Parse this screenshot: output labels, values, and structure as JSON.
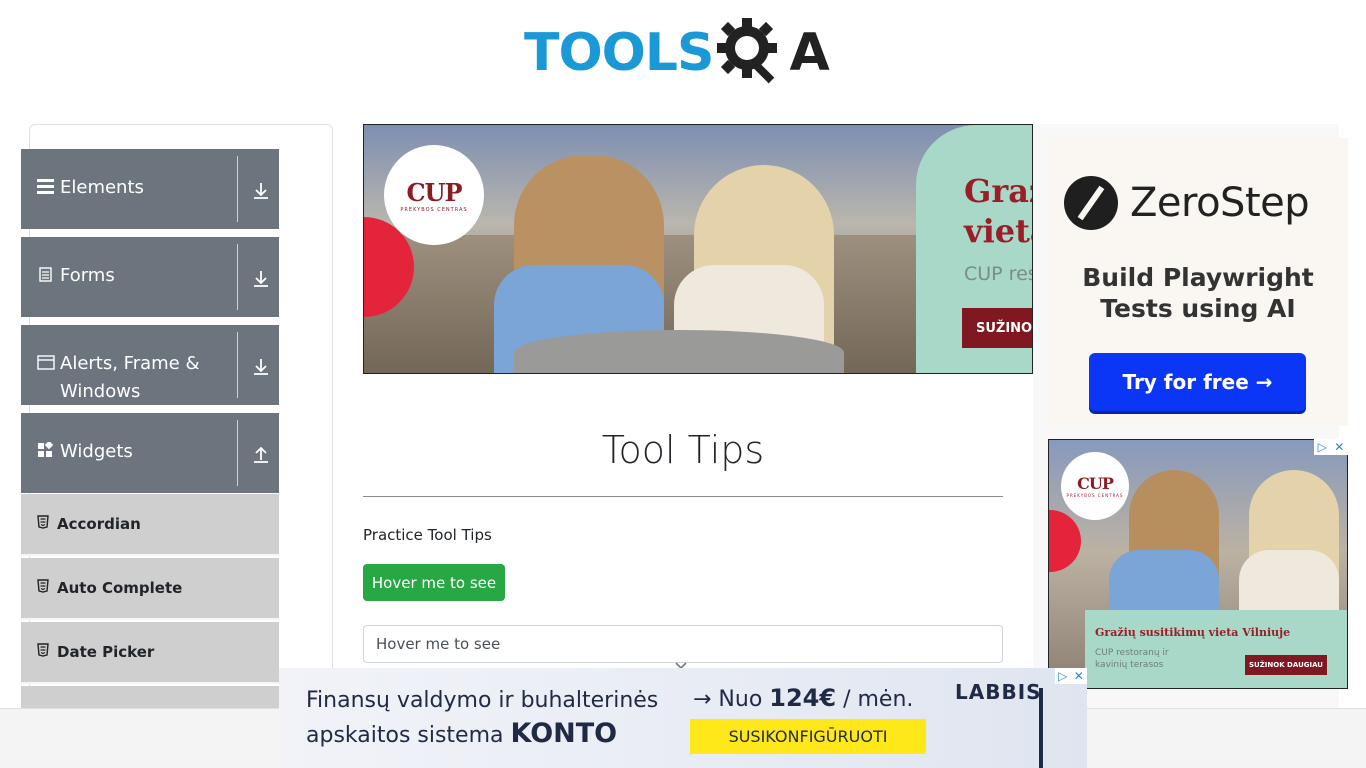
{
  "header": {
    "logo_text": "TOOLS",
    "logo_q_icon": "gear-magnifier-icon",
    "logo_a": "A"
  },
  "sidebar": {
    "groups": [
      {
        "label": "Elements",
        "icon": "hamburger-icon",
        "arrow": "download-icon"
      },
      {
        "label": "Forms",
        "icon": "form-icon",
        "arrow": "download-icon"
      },
      {
        "label": "Alerts, Frame & Windows",
        "label_l1": "Alerts, Frame &",
        "label_l2": "Windows",
        "icon": "window-icon",
        "arrow": "download-icon"
      },
      {
        "label": "Widgets",
        "icon": "widgets-icon",
        "arrow": "upload-icon"
      }
    ],
    "items": [
      {
        "label": "Accordian"
      },
      {
        "label": "Auto Complete"
      },
      {
        "label": "Date Picker"
      }
    ]
  },
  "banner_ad": {
    "brand": "CUP",
    "brand_sub": "PREKYBOS CENTRAS",
    "headline_l1": "Graž",
    "headline_l2": "vieta",
    "subtext": "CUP res",
    "button": "SUŽINOK"
  },
  "main": {
    "title": "Tool Tips",
    "practice_label": "Practice Tool Tips",
    "hover_button": "Hover me to see",
    "hover_input_placeholder": "Hover me to see"
  },
  "right_ad": {
    "brand": "ZeroStep",
    "tagline_l1": "Build Playwright",
    "tagline_l2": "Tests using AI",
    "button": "Try for free →"
  },
  "right_cup_ad": {
    "brand": "CUP",
    "brand_sub": "PREKYBOS CENTRAS",
    "headline": "Gražių susitikimų vieta Vilniuje",
    "subtext": "CUP restoranų ir kavinių terasos",
    "button": "SUŽINOK DAUGIAU",
    "adchoices": "▷",
    "close": "✕"
  },
  "bottom_ad": {
    "line1": "Finansų valdymo ir buhalterinės",
    "line2_prefix": "apskaitos sistema ",
    "line2_bold": "KONTO",
    "price_prefix": "→ Nuo ",
    "price_bold": "124€",
    "price_suffix": " / mėn.",
    "cta": "SUSIKONFIGŪRUOTI",
    "brand": "LABBIS",
    "adchoices": "▷",
    "close": "✕"
  },
  "colors": {
    "logo_blue": "#1b99d6",
    "sidebar_group": "#6c757d",
    "sidebar_item": "#cfcfcf",
    "success_green": "#28a745",
    "zerostep_blue": "#0b36f5",
    "cup_red": "#7f1820",
    "konto_yellow": "#ffe81a"
  }
}
